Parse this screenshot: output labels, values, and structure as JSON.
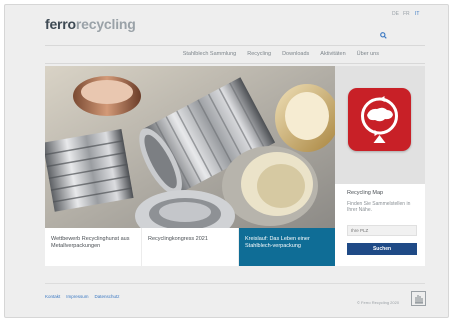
{
  "header": {
    "logo_part1": "ferro",
    "logo_part2": "recycling",
    "languages": [
      "DE",
      "FR",
      "IT"
    ]
  },
  "nav": {
    "items": [
      "Stahlblech Sammlung",
      "Recycling",
      "Downloads",
      "Aktivitäten",
      "Über uns"
    ]
  },
  "sidebar": {
    "map_title": "Recycling Map",
    "map_desc": "Finden Sie Sammelstellen in Ihrer Nähe.",
    "input_placeholder": "Ihre PLZ",
    "search_label": "Suchen"
  },
  "tiles": [
    {
      "label": "Wettbewerb Recyclinghunst aus Metallverpackungen"
    },
    {
      "label": "Recyclingkongress 2021"
    },
    {
      "label": "Kreislauf: Das Leben einer Stahlblech-verpackung"
    }
  ],
  "footer": {
    "links": [
      "Kontakt",
      "Impressum",
      "Datenschutz"
    ],
    "copyright": "© Ferro Recycling 2020"
  },
  "colors": {
    "brand_dark": "#3e4a54",
    "brand_light": "#9aa2a8",
    "accent_blue": "#1f4a86",
    "tile_active": "#0f6d96",
    "map_red": "#c82027"
  }
}
